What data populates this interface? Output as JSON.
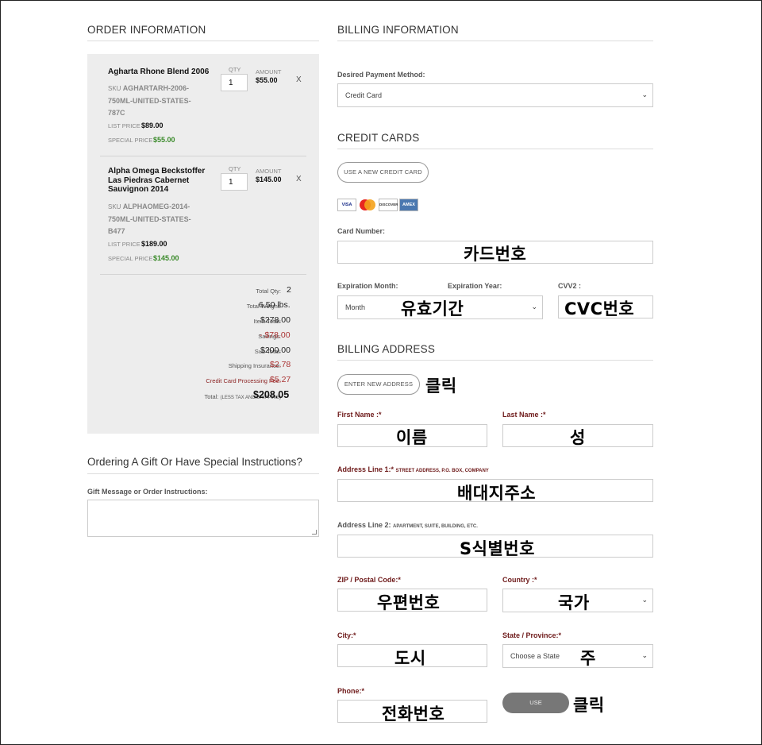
{
  "order": {
    "title": "ORDER INFORMATION",
    "items": [
      {
        "name": "Agharta Rhone Blend 2006",
        "sku_label": "SKU",
        "sku_lines": [
          "AGHARTARH-2006-",
          "750ML-UNITED-STATES-",
          "787C"
        ],
        "qty_label": "QTY",
        "qty": "1",
        "amount_label": "AMOUNT",
        "amount": "$55.00",
        "list_label": "LIST PRICE",
        "list_price": "$89.00",
        "special_label": "SPECIAL PRICE",
        "special_price": "$55.00",
        "remove": "X"
      },
      {
        "name_lines": [
          "Alpha Omega Beckstoffer",
          "Las Piedras Cabernet",
          "Sauvignon 2014"
        ],
        "sku_label": "SKU",
        "sku_lines": [
          "ALPHAOMEG-2014-",
          "750ML-UNITED-STATES-",
          "B477"
        ],
        "qty_label": "QTY",
        "qty": "1",
        "amount_label": "AMOUNT",
        "amount": "$145.00",
        "list_label": "LIST PRICE",
        "list_price": "$189.00",
        "special_label": "SPECIAL PRICE",
        "special_price": "$145.00",
        "remove": "X"
      }
    ],
    "totals": {
      "qty_label": "Total Qty:",
      "qty": "2",
      "weight_label": "Total Weight:",
      "weight": "6.50 lbs.",
      "item_total_label": "Item Total:",
      "item_total": "$278.00",
      "savings_label": "Savings:",
      "savings": "- $78.00",
      "sub_total_label": "Sub Total:",
      "sub_total": "$200.00",
      "insurance_label": "Shipping Insurance:",
      "insurance": "$2.78",
      "cc_fee_label": "Credit Card Processing Fee:",
      "cc_fee": "$5.27",
      "total_label": "Total:",
      "total_note": "(LESS TAX AND SHIPPING)",
      "total": "$208.05"
    }
  },
  "gift": {
    "title": "Ordering A Gift Or Have Special Instructions?",
    "label": "Gift Message or Order Instructions:",
    "value": ""
  },
  "billing": {
    "title": "BILLING INFORMATION",
    "payment_label": "Desired Payment Method:",
    "payment_value": "Credit Card",
    "credit_cards_title": "CREDIT CARDS",
    "use_new_card": "USE A NEW CREDIT CARD",
    "card_logos": [
      "VISA",
      "MC",
      "DISCOVER",
      "AMEX"
    ],
    "card_number_label": "Card Number:",
    "exp_month_label": "Expiration Month:",
    "exp_month_value": "Month",
    "exp_year_label": "Expiration Year:",
    "cvv_label": "CVV2 :"
  },
  "address": {
    "title": "BILLING ADDRESS",
    "enter_new": "ENTER NEW ADDRESS",
    "first_name_label": "First Name :*",
    "last_name_label": "Last Name :*",
    "address1_label": "Address Line 1:*",
    "address1_hint": "STREET ADDRESS, P.O. BOX, COMPANY",
    "address2_label": "Address Line 2:",
    "address2_hint": "APARTMENT, SUITE, BUILDING, ETC.",
    "zip_label": "ZIP / Postal Code:*",
    "country_label": "Country :*",
    "city_label": "City:*",
    "state_label": "State / Province:*",
    "state_value": "Choose a State",
    "phone_label": "Phone:*",
    "use_button": "USE"
  },
  "annotations": {
    "card_number": "카드번호",
    "expiry": "유효기간",
    "cvc": "CVC번호",
    "click_address": "클릭",
    "first_name": "이름",
    "last_name": "성",
    "address1": "배대지주소",
    "address2": "S식별번호",
    "zip": "우편번호",
    "country": "국가",
    "city": "도시",
    "state": "주",
    "phone": "전화번호",
    "click_use": "클릭"
  },
  "colors": {
    "panel_bg": "#ededed",
    "special_price": "#3a8a2a",
    "savings_red": "#aa3333",
    "required_label": "#6e1a1a",
    "use_button_bg": "#777777"
  }
}
